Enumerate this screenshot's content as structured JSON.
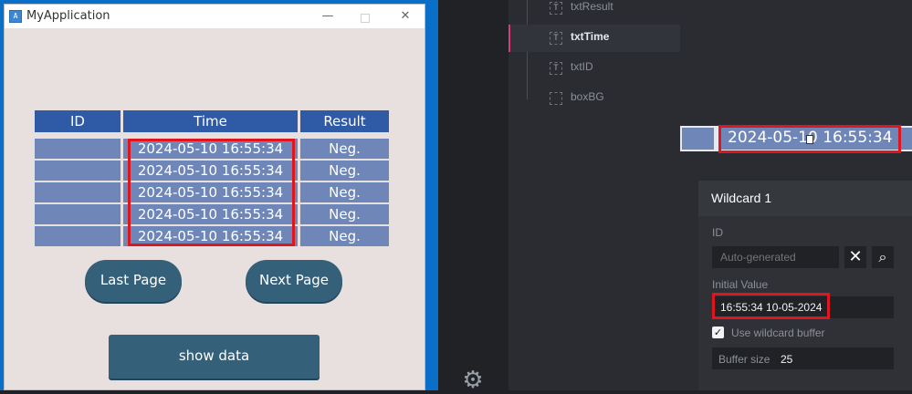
{
  "app": {
    "icon_text": "A",
    "title": "MyApplication",
    "window_controls": {
      "minimize": "—",
      "maximize": "",
      "close": "✕"
    },
    "table": {
      "headers": [
        "ID",
        "Time",
        "Result"
      ],
      "rows": [
        {
          "id": "",
          "time": "2024-05-10 16:55:34",
          "result": "Neg."
        },
        {
          "id": "",
          "time": "2024-05-10 16:55:34",
          "result": "Neg."
        },
        {
          "id": "",
          "time": "2024-05-10 16:55:34",
          "result": "Neg."
        },
        {
          "id": "",
          "time": "2024-05-10 16:55:34",
          "result": "Neg."
        },
        {
          "id": "",
          "time": "2024-05-10 16:55:34",
          "result": "Neg."
        }
      ]
    },
    "buttons": {
      "last_page": "Last Page",
      "next_page": "Next Page",
      "show_data": "show data"
    }
  },
  "editor": {
    "tree": {
      "items": [
        {
          "label": "txtResult",
          "icon": "T",
          "selected": false
        },
        {
          "label": "txtTime",
          "icon": "T",
          "selected": true
        },
        {
          "label": "txtID",
          "icon": "T",
          "selected": false
        },
        {
          "label": "boxBG",
          "icon": "",
          "selected": false
        }
      ]
    },
    "preview": {
      "value": "2024-05-10 16:55:34"
    },
    "wildcard": {
      "title": "Wildcard 1",
      "id_label": "ID",
      "id_placeholder": "Auto-generated",
      "clear_icon": "✕",
      "search_icon": "⌕",
      "initial_label": "Initial Value",
      "initial_value": "16:55:34 10-05-2024",
      "use_buffer_label": "Use wildcard buffer",
      "use_buffer_checked": true,
      "buffer_size_label": "Buffer size",
      "buffer_size_value": "25"
    },
    "gear_icon": "⚙"
  },
  "colors": {
    "highlight": "#e0161f",
    "table_header": "#2f5aa6",
    "table_cell": "#6f86b8",
    "button": "#356079",
    "selected_accent": "#d63b7a"
  }
}
